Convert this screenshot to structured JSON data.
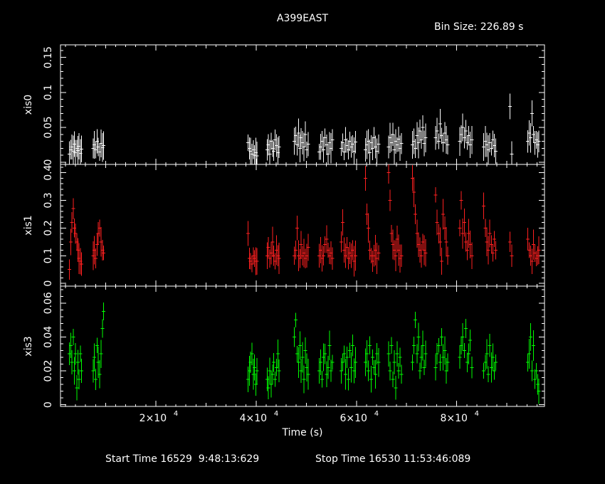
{
  "title": "A399EAST",
  "bin_size_text": "Bin Size: 226.89 s",
  "xlabel": "Time (s)",
  "start_time_text": "Start Time 16529  9:48:13:629",
  "stop_time_text": "Stop Time 16530 11:53:46:089",
  "colors": {
    "xis0": "#ffffff",
    "xis1": "#ff2020",
    "xis3": "#00ff00",
    "axis": "#ffffff"
  },
  "chart_data": {
    "type": "scatter",
    "xlim": [
      1000,
      97500
    ],
    "x_ticks": [
      20000,
      40000,
      60000,
      80000
    ],
    "x_tick_labels": [
      [
        "2×10",
        "4"
      ],
      [
        "4×10",
        "4"
      ],
      [
        "6×10",
        "4"
      ],
      [
        "8×10",
        "4"
      ]
    ],
    "panels": [
      {
        "name": "xis0",
        "ylabel": "xis0",
        "color": "#ffffff",
        "ylim": [
          -0.003,
          0.168
        ],
        "yticks": [
          0,
          0.05,
          0.1,
          0.15
        ],
        "ytick_labels": [
          "0",
          "0.05",
          "0.1",
          "0.15"
        ],
        "segments": [
          {
            "t0": 2800,
            "t1": 5200,
            "values": [
              0.012,
              0.018,
              0.022,
              0.016,
              0.026,
              0.014,
              0.02,
              0.017,
              0.023,
              0.013,
              0.019
            ]
          },
          {
            "t0": 7500,
            "t1": 9600,
            "values": [
              0.02,
              0.025,
              0.018,
              0.03,
              0.022,
              0.015,
              0.027,
              0.021,
              0.024
            ]
          },
          {
            "t0": 38400,
            "t1": 40200,
            "values": [
              0.028,
              0.02,
              0.016,
              0.012,
              0.018,
              0.01,
              0.014,
              0.009
            ]
          },
          {
            "t0": 42200,
            "t1": 44600,
            "values": [
              0.018,
              0.025,
              0.012,
              0.03,
              0.02,
              0.016,
              0.032,
              0.024,
              0.014,
              0.022
            ]
          },
          {
            "t0": 47600,
            "t1": 50400,
            "values": [
              0.03,
              0.038,
              0.025,
              0.042,
              0.02,
              0.035,
              0.028,
              0.022,
              0.04,
              0.018,
              0.026
            ]
          },
          {
            "t0": 52600,
            "t1": 55200,
            "values": [
              0.015,
              0.022,
              0.03,
              0.018,
              0.035,
              0.025,
              0.012,
              0.028,
              0.02,
              0.032
            ]
          },
          {
            "t0": 57000,
            "t1": 59800,
            "values": [
              0.02,
              0.028,
              0.015,
              0.032,
              0.024,
              0.018,
              0.03,
              0.022,
              0.026,
              0.016,
              0.029
            ]
          },
          {
            "t0": 61800,
            "t1": 64400,
            "values": [
              0.018,
              0.025,
              0.03,
              0.014,
              0.028,
              0.02,
              0.035,
              0.022,
              0.016,
              0.026
            ]
          },
          {
            "t0": 66400,
            "t1": 69000,
            "values": [
              0.022,
              0.035,
              0.028,
              0.04,
              0.018,
              0.03,
              0.025,
              0.033,
              0.02,
              0.027
            ]
          },
          {
            "t0": 71200,
            "t1": 73800,
            "values": [
              0.025,
              0.03,
              0.02,
              0.038,
              0.028,
              0.045,
              0.032,
              0.05,
              0.027,
              0.035
            ]
          },
          {
            "t0": 75800,
            "t1": 78200,
            "values": [
              0.035,
              0.045,
              0.03,
              0.055,
              0.038,
              0.028,
              0.042,
              0.032,
              0.025
            ]
          },
          {
            "t0": 80600,
            "t1": 83000,
            "values": [
              0.03,
              0.04,
              0.05,
              0.035,
              0.045,
              0.028,
              0.038,
              0.025,
              0.032
            ]
          },
          {
            "t0": 85400,
            "t1": 87800,
            "values": [
              0.022,
              0.03,
              0.025,
              0.018,
              0.028,
              0.02,
              0.032,
              0.024,
              0.016
            ]
          },
          {
            "t0": 90600,
            "t1": 91000,
            "values": [
              0.08,
              0.012
            ]
          },
          {
            "t0": 94200,
            "t1": 96400,
            "values": [
              0.03,
              0.042,
              0.035,
              0.07,
              0.04,
              0.028,
              0.032,
              0.025,
              0.03
            ]
          }
        ]
      },
      {
        "name": "xis1",
        "ylabel": "xis1",
        "color": "#ff2020",
        "ylim": [
          -0.01,
          0.43
        ],
        "yticks": [
          0,
          0.1,
          0.2,
          0.3,
          0.4
        ],
        "ytick_labels": [
          "0",
          "0.1",
          "0.2",
          "0.3",
          "0.4"
        ],
        "segments": [
          {
            "t0": 2800,
            "t1": 5200,
            "values": [
              0.05,
              0.15,
              0.22,
              0.27,
              0.2,
              0.18,
              0.15,
              0.12,
              0.09,
              0.08,
              0.07
            ]
          },
          {
            "t0": 7500,
            "t1": 9600,
            "values": [
              0.1,
              0.12,
              0.09,
              0.14,
              0.18,
              0.2,
              0.15,
              0.12,
              0.11
            ]
          },
          {
            "t0": 38400,
            "t1": 40200,
            "values": [
              0.18,
              0.09,
              0.08,
              0.07,
              0.1,
              0.09,
              0.08,
              0.08
            ]
          },
          {
            "t0": 42200,
            "t1": 44600,
            "values": [
              0.1,
              0.13,
              0.09,
              0.11,
              0.15,
              0.1,
              0.08,
              0.12,
              0.1,
              0.09
            ]
          },
          {
            "t0": 47600,
            "t1": 50400,
            "values": [
              0.1,
              0.12,
              0.2,
              0.1,
              0.09,
              0.14,
              0.1,
              0.11,
              0.09,
              0.1,
              0.13
            ]
          },
          {
            "t0": 52600,
            "t1": 55200,
            "values": [
              0.1,
              0.12,
              0.09,
              0.1,
              0.14,
              0.16,
              0.12,
              0.1,
              0.11,
              0.09
            ]
          },
          {
            "t0": 57000,
            "t1": 59800,
            "values": [
              0.15,
              0.22,
              0.12,
              0.1,
              0.13,
              0.09,
              0.11,
              0.1,
              0.12,
              0.08,
              0.1
            ]
          },
          {
            "t0": 61800,
            "t1": 64400,
            "values": [
              0.38,
              0.25,
              0.2,
              0.12,
              0.1,
              0.08,
              0.1,
              0.12,
              0.09,
              0.11
            ]
          },
          {
            "t0": 66400,
            "t1": 69000,
            "values": [
              0.4,
              0.3,
              0.18,
              0.14,
              0.12,
              0.1,
              0.16,
              0.12,
              0.09,
              0.1
            ]
          },
          {
            "t0": 71200,
            "t1": 73800,
            "values": [
              0.38,
              0.33,
              0.25,
              0.18,
              0.14,
              0.12,
              0.1,
              0.15,
              0.12,
              0.11
            ]
          },
          {
            "t0": 75800,
            "t1": 78200,
            "values": [
              0.32,
              0.22,
              0.18,
              0.15,
              0.08,
              0.25,
              0.2,
              0.15,
              0.1
            ]
          },
          {
            "t0": 80600,
            "t1": 83000,
            "values": [
              0.2,
              0.3,
              0.18,
              0.22,
              0.15,
              0.12,
              0.18,
              0.14,
              0.1
            ]
          },
          {
            "t0": 85400,
            "t1": 87800,
            "values": [
              0.28,
              0.2,
              0.15,
              0.12,
              0.18,
              0.14,
              0.11,
              0.16,
              0.12
            ]
          },
          {
            "t0": 90600,
            "t1": 91000,
            "values": [
              0.15,
              0.1
            ]
          },
          {
            "t0": 94200,
            "t1": 96400,
            "values": [
              0.16,
              0.12,
              0.1,
              0.08,
              0.14,
              0.11,
              0.09,
              0.1,
              0.12
            ]
          }
        ]
      },
      {
        "name": "xis3",
        "ylabel": "xis3",
        "color": "#00ff00",
        "ylim": [
          -0.001,
          0.07
        ],
        "yticks": [
          0,
          0.02,
          0.04,
          0.06
        ],
        "ytick_labels": [
          "0",
          "0.02",
          "0.04",
          "0.06"
        ],
        "segments": [
          {
            "t0": 2800,
            "t1": 5200,
            "values": [
              0.03,
              0.035,
              0.025,
              0.04,
              0.02,
              0.03,
              0.01,
              0.025,
              0.015,
              0.03,
              0.02
            ]
          },
          {
            "t0": 7500,
            "t1": 9600,
            "values": [
              0.02,
              0.028,
              0.015,
              0.035,
              0.025,
              0.018,
              0.03,
              0.045,
              0.055
            ]
          },
          {
            "t0": 38400,
            "t1": 40200,
            "values": [
              0.015,
              0.02,
              0.025,
              0.03,
              0.018,
              0.022,
              0.012,
              0.02
            ]
          },
          {
            "t0": 42200,
            "t1": 44600,
            "values": [
              0.015,
              0.01,
              0.02,
              0.012,
              0.018,
              0.025,
              0.015,
              0.022,
              0.03,
              0.02
            ]
          },
          {
            "t0": 47600,
            "t1": 50400,
            "values": [
              0.04,
              0.05,
              0.03,
              0.025,
              0.035,
              0.02,
              0.028,
              0.015,
              0.032,
              0.022,
              0.018
            ]
          },
          {
            "t0": 52600,
            "t1": 55200,
            "values": [
              0.02,
              0.025,
              0.015,
              0.028,
              0.03,
              0.018,
              0.022,
              0.035,
              0.02,
              0.025
            ]
          },
          {
            "t0": 57000,
            "t1": 59800,
            "values": [
              0.02,
              0.025,
              0.03,
              0.018,
              0.028,
              0.015,
              0.032,
              0.022,
              0.035,
              0.02,
              0.025
            ]
          },
          {
            "t0": 61800,
            "t1": 64400,
            "values": [
              0.025,
              0.03,
              0.02,
              0.035,
              0.015,
              0.028,
              0.022,
              0.018,
              0.03,
              0.025
            ]
          },
          {
            "t0": 66400,
            "t1": 69000,
            "values": [
              0.03,
              0.02,
              0.035,
              0.015,
              0.025,
              0.01,
              0.03,
              0.02,
              0.028,
              0.018
            ]
          },
          {
            "t0": 71200,
            "t1": 73800,
            "values": [
              0.025,
              0.035,
              0.05,
              0.03,
              0.04,
              0.02,
              0.028,
              0.035,
              0.022,
              0.03
            ]
          },
          {
            "t0": 75800,
            "t1": 78200,
            "values": [
              0.022,
              0.03,
              0.035,
              0.025,
              0.04,
              0.028,
              0.032,
              0.02,
              0.025
            ]
          },
          {
            "t0": 80600,
            "t1": 83000,
            "values": [
              0.028,
              0.035,
              0.04,
              0.032,
              0.045,
              0.025,
              0.03,
              0.038,
              0.022
            ]
          },
          {
            "t0": 85400,
            "t1": 87800,
            "values": [
              0.02,
              0.025,
              0.03,
              0.018,
              0.035,
              0.022,
              0.028,
              0.02,
              0.025
            ]
          },
          {
            "t0": 94200,
            "t1": 96400,
            "values": [
              0.025,
              0.03,
              0.04,
              0.02,
              0.035,
              0.015,
              0.02,
              0.012,
              0.008
            ]
          }
        ]
      }
    ]
  }
}
